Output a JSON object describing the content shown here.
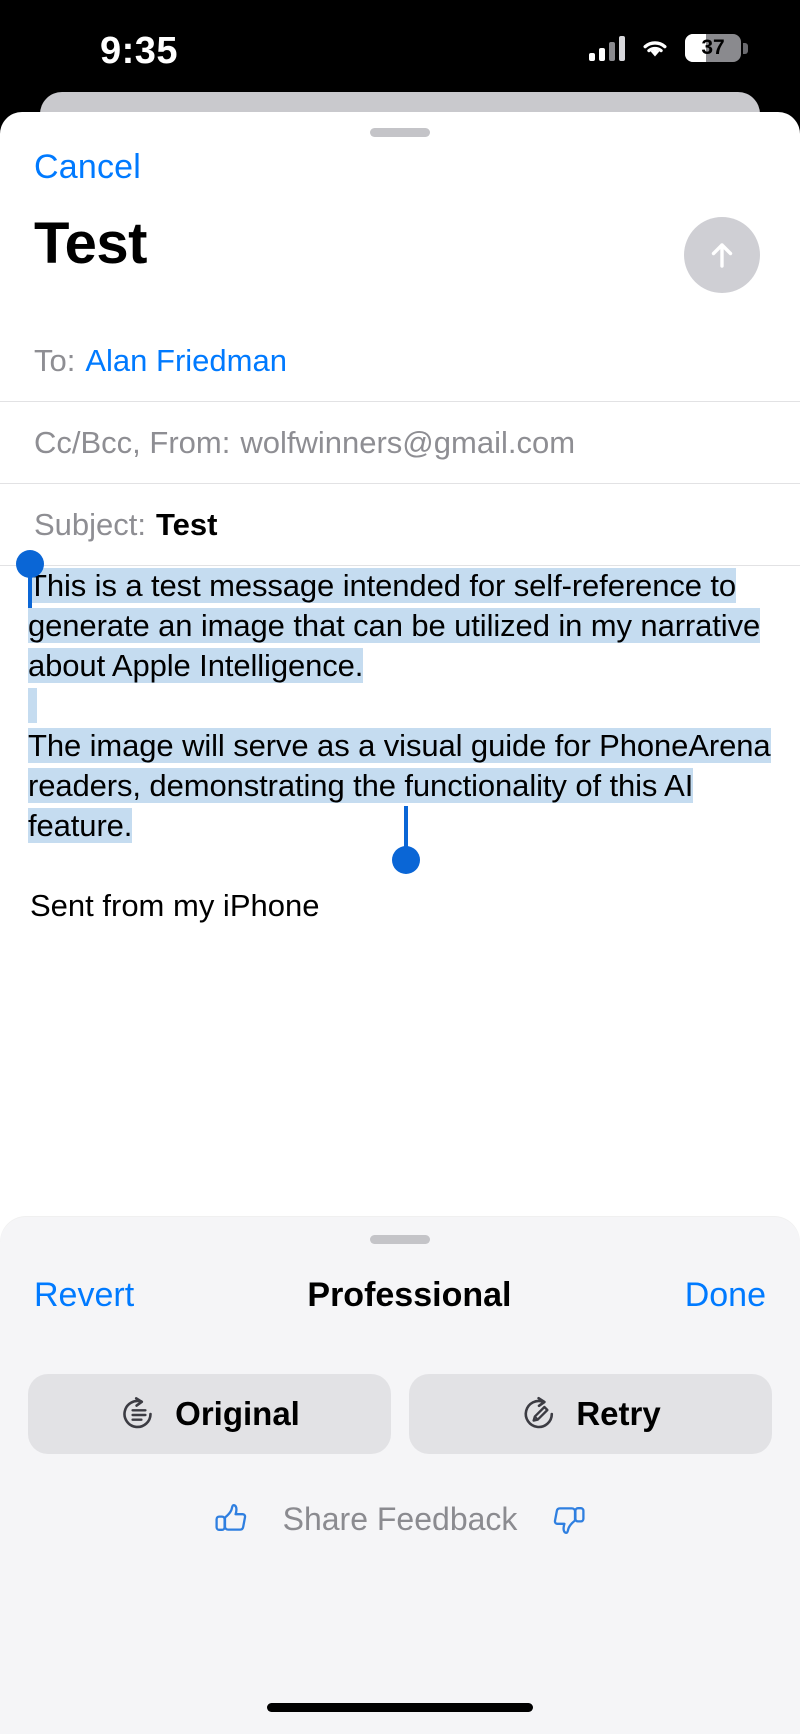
{
  "status_bar": {
    "time": "9:35",
    "battery_percent": "37",
    "battery_level": 37,
    "cellular_icon": "cellular-bars-icon",
    "wifi_icon": "wifi-icon",
    "battery_icon": "battery-icon"
  },
  "compose": {
    "cancel_label": "Cancel",
    "title": "Test",
    "send_icon": "send-arrow-up-icon",
    "to_label": "To:",
    "to_value": "Alan Friedman",
    "cc_bcc_from_label": "Cc/Bcc, From:",
    "from_value": "wolfwinners@gmail.com",
    "subject_label": "Subject:",
    "subject_value": "Test",
    "body_paragraph_1": "This is a test message intended for self-reference to generate an image that can be utilized in my narrative about Apple Intelligence.",
    "body_paragraph_2": "The image will serve as a visual guide for PhoneArena readers, demonstrating the functionality of this AI feature.",
    "signature": "Sent from my iPhone",
    "selection_highlight_color": "#c5dcf0",
    "selection_handle_color": "#0a66d6"
  },
  "writing_tools": {
    "revert_label": "Revert",
    "style_label": "Professional",
    "done_label": "Done",
    "original_label": "Original",
    "original_icon": "revert-lines-circle-icon",
    "retry_label": "Retry",
    "retry_icon": "retry-pencil-circle-icon",
    "feedback_label": "Share Feedback",
    "thumbs_up_icon": "thumbs-up-icon",
    "thumbs_down_icon": "thumbs-down-icon",
    "accent_color": "#007aff",
    "panel_background": "#f5f5f7"
  }
}
